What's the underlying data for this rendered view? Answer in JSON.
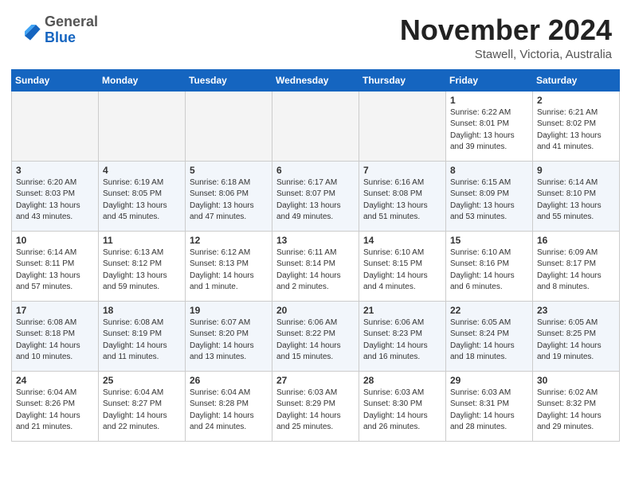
{
  "header": {
    "logo_general": "General",
    "logo_blue": "Blue",
    "title": "November 2024",
    "location": "Stawell, Victoria, Australia"
  },
  "weekdays": [
    "Sunday",
    "Monday",
    "Tuesday",
    "Wednesday",
    "Thursday",
    "Friday",
    "Saturday"
  ],
  "weeks": [
    [
      {
        "day": "",
        "info": ""
      },
      {
        "day": "",
        "info": ""
      },
      {
        "day": "",
        "info": ""
      },
      {
        "day": "",
        "info": ""
      },
      {
        "day": "",
        "info": ""
      },
      {
        "day": "1",
        "info": "Sunrise: 6:22 AM\nSunset: 8:01 PM\nDaylight: 13 hours\nand 39 minutes."
      },
      {
        "day": "2",
        "info": "Sunrise: 6:21 AM\nSunset: 8:02 PM\nDaylight: 13 hours\nand 41 minutes."
      }
    ],
    [
      {
        "day": "3",
        "info": "Sunrise: 6:20 AM\nSunset: 8:03 PM\nDaylight: 13 hours\nand 43 minutes."
      },
      {
        "day": "4",
        "info": "Sunrise: 6:19 AM\nSunset: 8:05 PM\nDaylight: 13 hours\nand 45 minutes."
      },
      {
        "day": "5",
        "info": "Sunrise: 6:18 AM\nSunset: 8:06 PM\nDaylight: 13 hours\nand 47 minutes."
      },
      {
        "day": "6",
        "info": "Sunrise: 6:17 AM\nSunset: 8:07 PM\nDaylight: 13 hours\nand 49 minutes."
      },
      {
        "day": "7",
        "info": "Sunrise: 6:16 AM\nSunset: 8:08 PM\nDaylight: 13 hours\nand 51 minutes."
      },
      {
        "day": "8",
        "info": "Sunrise: 6:15 AM\nSunset: 8:09 PM\nDaylight: 13 hours\nand 53 minutes."
      },
      {
        "day": "9",
        "info": "Sunrise: 6:14 AM\nSunset: 8:10 PM\nDaylight: 13 hours\nand 55 minutes."
      }
    ],
    [
      {
        "day": "10",
        "info": "Sunrise: 6:14 AM\nSunset: 8:11 PM\nDaylight: 13 hours\nand 57 minutes."
      },
      {
        "day": "11",
        "info": "Sunrise: 6:13 AM\nSunset: 8:12 PM\nDaylight: 13 hours\nand 59 minutes."
      },
      {
        "day": "12",
        "info": "Sunrise: 6:12 AM\nSunset: 8:13 PM\nDaylight: 14 hours\nand 1 minute."
      },
      {
        "day": "13",
        "info": "Sunrise: 6:11 AM\nSunset: 8:14 PM\nDaylight: 14 hours\nand 2 minutes."
      },
      {
        "day": "14",
        "info": "Sunrise: 6:10 AM\nSunset: 8:15 PM\nDaylight: 14 hours\nand 4 minutes."
      },
      {
        "day": "15",
        "info": "Sunrise: 6:10 AM\nSunset: 8:16 PM\nDaylight: 14 hours\nand 6 minutes."
      },
      {
        "day": "16",
        "info": "Sunrise: 6:09 AM\nSunset: 8:17 PM\nDaylight: 14 hours\nand 8 minutes."
      }
    ],
    [
      {
        "day": "17",
        "info": "Sunrise: 6:08 AM\nSunset: 8:18 PM\nDaylight: 14 hours\nand 10 minutes."
      },
      {
        "day": "18",
        "info": "Sunrise: 6:08 AM\nSunset: 8:19 PM\nDaylight: 14 hours\nand 11 minutes."
      },
      {
        "day": "19",
        "info": "Sunrise: 6:07 AM\nSunset: 8:20 PM\nDaylight: 14 hours\nand 13 minutes."
      },
      {
        "day": "20",
        "info": "Sunrise: 6:06 AM\nSunset: 8:22 PM\nDaylight: 14 hours\nand 15 minutes."
      },
      {
        "day": "21",
        "info": "Sunrise: 6:06 AM\nSunset: 8:23 PM\nDaylight: 14 hours\nand 16 minutes."
      },
      {
        "day": "22",
        "info": "Sunrise: 6:05 AM\nSunset: 8:24 PM\nDaylight: 14 hours\nand 18 minutes."
      },
      {
        "day": "23",
        "info": "Sunrise: 6:05 AM\nSunset: 8:25 PM\nDaylight: 14 hours\nand 19 minutes."
      }
    ],
    [
      {
        "day": "24",
        "info": "Sunrise: 6:04 AM\nSunset: 8:26 PM\nDaylight: 14 hours\nand 21 minutes."
      },
      {
        "day": "25",
        "info": "Sunrise: 6:04 AM\nSunset: 8:27 PM\nDaylight: 14 hours\nand 22 minutes."
      },
      {
        "day": "26",
        "info": "Sunrise: 6:04 AM\nSunset: 8:28 PM\nDaylight: 14 hours\nand 24 minutes."
      },
      {
        "day": "27",
        "info": "Sunrise: 6:03 AM\nSunset: 8:29 PM\nDaylight: 14 hours\nand 25 minutes."
      },
      {
        "day": "28",
        "info": "Sunrise: 6:03 AM\nSunset: 8:30 PM\nDaylight: 14 hours\nand 26 minutes."
      },
      {
        "day": "29",
        "info": "Sunrise: 6:03 AM\nSunset: 8:31 PM\nDaylight: 14 hours\nand 28 minutes."
      },
      {
        "day": "30",
        "info": "Sunrise: 6:02 AM\nSunset: 8:32 PM\nDaylight: 14 hours\nand 29 minutes."
      }
    ]
  ]
}
